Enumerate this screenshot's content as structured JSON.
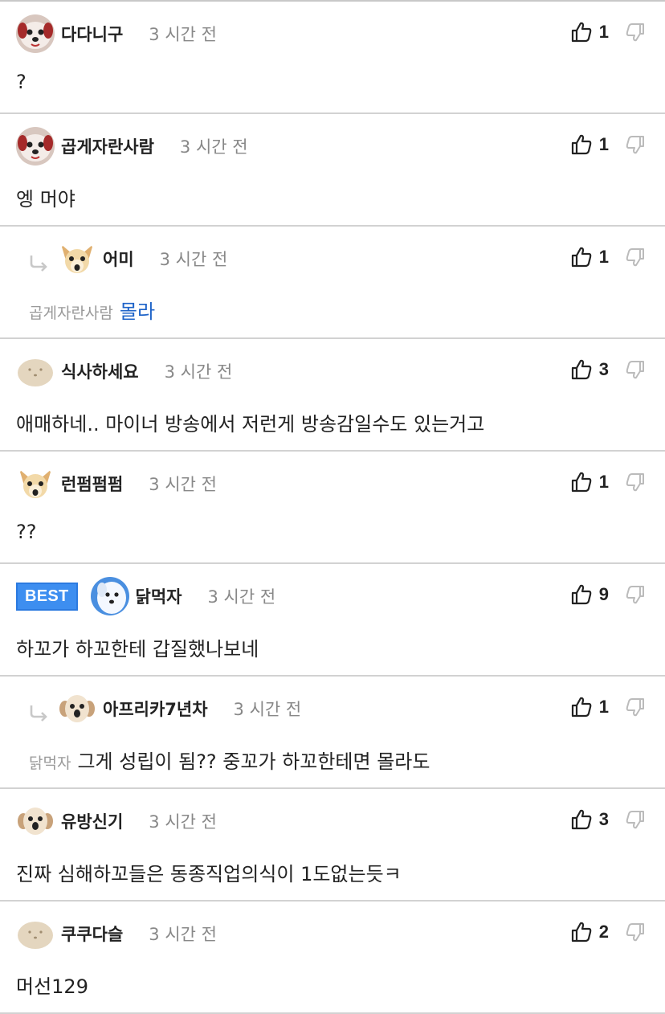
{
  "comments": [
    {
      "name": "다다니구",
      "time": "3 시간 전",
      "likes": "1",
      "text": "?",
      "reply": false,
      "best": false,
      "avatar": "dog-face-avatar"
    },
    {
      "name": "곱게자란사람",
      "time": "3 시간 전",
      "likes": "1",
      "text": "엥 머야",
      "reply": false,
      "best": false,
      "avatar": "dog-face-avatar"
    },
    {
      "name": "어미",
      "time": "3 시간 전",
      "likes": "1",
      "mention": "곱게자란사람",
      "text": "몰라",
      "reply": true,
      "best": false,
      "avatar": "chihuahua-avatar"
    },
    {
      "name": "식사하세요",
      "time": "3 시간 전",
      "likes": "3",
      "text": "애매하네.. 마이너 방송에서 저런게 방송감일수도 있는거고",
      "reply": false,
      "best": false,
      "avatar": "blob-avatar"
    },
    {
      "name": "런펌펌펌",
      "time": "3 시간 전",
      "likes": "1",
      "text": "??",
      "reply": false,
      "best": false,
      "avatar": "chihuahua-avatar"
    },
    {
      "name": "닭먹자",
      "time": "3 시간 전",
      "likes": "9",
      "text": "하꼬가 하꼬한테 갑질했나보네",
      "reply": false,
      "best": true,
      "best_label": "BEST",
      "avatar": "white-dog-avatar"
    },
    {
      "name": "아프리카7년차",
      "time": "3 시간 전",
      "likes": "1",
      "mention": "닭먹자",
      "text": "그게 성립이 됨?? 중꼬가 하꼬한테면 몰라도",
      "reply": true,
      "best": false,
      "avatar": "puppy-avatar"
    },
    {
      "name": "유방신기",
      "time": "3 시간 전",
      "likes": "3",
      "text": "진짜 심해하꼬들은 동종직업의식이 1도없는듯ㅋ",
      "reply": false,
      "best": false,
      "avatar": "puppy-avatar"
    },
    {
      "name": "쿠쿠다슬",
      "time": "3 시간 전",
      "likes": "2",
      "text": "머선129",
      "reply": false,
      "best": false,
      "avatar": "blob-avatar"
    }
  ],
  "colors": {
    "best": "#3d8ef0",
    "mention_blue": "#1e63c8",
    "divider": "#d2d2d2"
  }
}
